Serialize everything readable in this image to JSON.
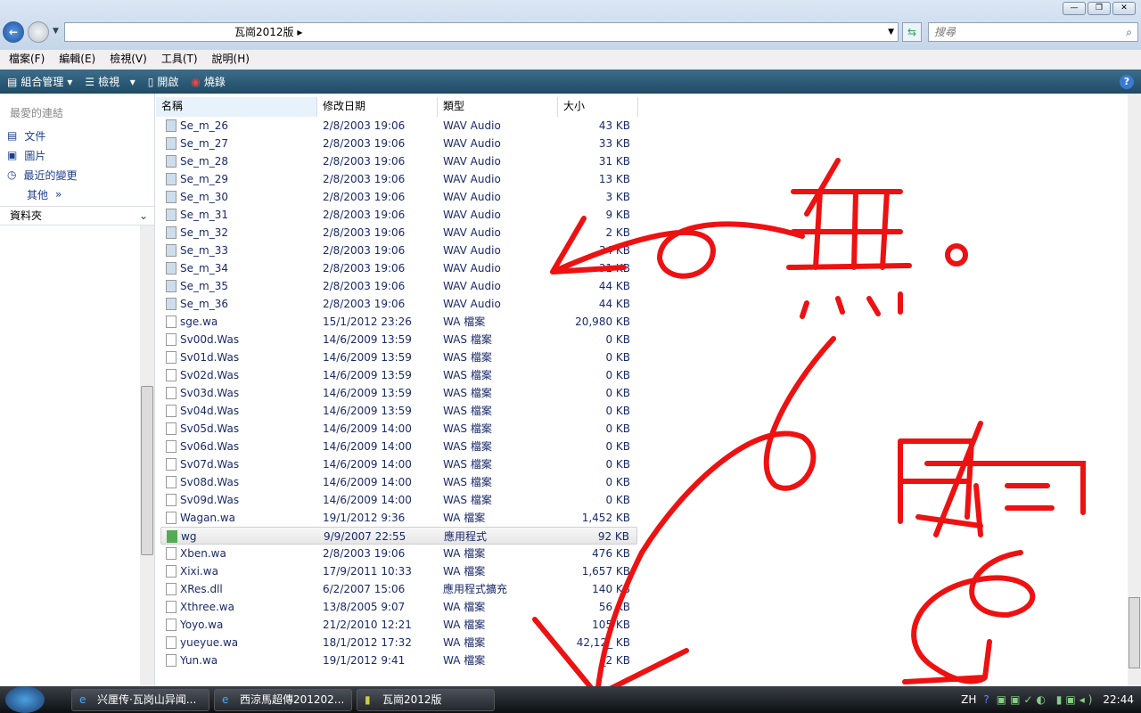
{
  "address": {
    "path": "瓦崗2012版",
    "search_placeholder": "搜尋"
  },
  "menu": [
    "檔案(F)",
    "編輯(E)",
    "檢視(V)",
    "工具(T)",
    "說明(H)"
  ],
  "toolbar": {
    "organize": "組合管理",
    "view": "檢視",
    "open": "開啟",
    "burn": "燒錄",
    "help": "?"
  },
  "nav": {
    "favorites_header": "最愛的連結",
    "items": [
      "文件",
      "圖片",
      "最近的變更",
      "其他"
    ],
    "folders": "資料夾"
  },
  "columns": [
    "名稱",
    "修改日期",
    "類型",
    "大小"
  ],
  "files": [
    [
      "Se_m_26",
      "2/8/2003 19:06",
      "WAV Audio",
      "43 KB"
    ],
    [
      "Se_m_27",
      "2/8/2003 19:06",
      "WAV Audio",
      "33 KB"
    ],
    [
      "Se_m_28",
      "2/8/2003 19:06",
      "WAV Audio",
      "31 KB"
    ],
    [
      "Se_m_29",
      "2/8/2003 19:06",
      "WAV Audio",
      "13 KB"
    ],
    [
      "Se_m_30",
      "2/8/2003 19:06",
      "WAV Audio",
      "3 KB"
    ],
    [
      "Se_m_31",
      "2/8/2003 19:06",
      "WAV Audio",
      "9 KB"
    ],
    [
      "Se_m_32",
      "2/8/2003 19:06",
      "WAV Audio",
      "2 KB"
    ],
    [
      "Se_m_33",
      "2/8/2003 19:06",
      "WAV Audio",
      "34 KB"
    ],
    [
      "Se_m_34",
      "2/8/2003 19:06",
      "WAV Audio",
      "31 KB"
    ],
    [
      "Se_m_35",
      "2/8/2003 19:06",
      "WAV Audio",
      "44 KB"
    ],
    [
      "Se_m_36",
      "2/8/2003 19:06",
      "WAV Audio",
      "44 KB"
    ],
    [
      "sge.wa",
      "15/1/2012 23:26",
      "WA 檔案",
      "20,980 KB"
    ],
    [
      "Sv00d.Was",
      "14/6/2009 13:59",
      "WAS 檔案",
      "0 KB"
    ],
    [
      "Sv01d.Was",
      "14/6/2009 13:59",
      "WAS 檔案",
      "0 KB"
    ],
    [
      "Sv02d.Was",
      "14/6/2009 13:59",
      "WAS 檔案",
      "0 KB"
    ],
    [
      "Sv03d.Was",
      "14/6/2009 13:59",
      "WAS 檔案",
      "0 KB"
    ],
    [
      "Sv04d.Was",
      "14/6/2009 13:59",
      "WAS 檔案",
      "0 KB"
    ],
    [
      "Sv05d.Was",
      "14/6/2009 14:00",
      "WAS 檔案",
      "0 KB"
    ],
    [
      "Sv06d.Was",
      "14/6/2009 14:00",
      "WAS 檔案",
      "0 KB"
    ],
    [
      "Sv07d.Was",
      "14/6/2009 14:00",
      "WAS 檔案",
      "0 KB"
    ],
    [
      "Sv08d.Was",
      "14/6/2009 14:00",
      "WAS 檔案",
      "0 KB"
    ],
    [
      "Sv09d.Was",
      "14/6/2009 14:00",
      "WAS 檔案",
      "0 KB"
    ],
    [
      "Wagan.wa",
      "19/1/2012 9:36",
      "WA 檔案",
      "1,452 KB"
    ],
    [
      "wg",
      "9/9/2007 22:55",
      "應用程式",
      "92 KB"
    ],
    [
      "Xben.wa",
      "2/8/2003 19:06",
      "WA 檔案",
      "476 KB"
    ],
    [
      "Xixi.wa",
      "17/9/2011 10:33",
      "WA 檔案",
      "1,657 KB"
    ],
    [
      "XRes.dll",
      "6/2/2007 15:06",
      "應用程式擴充",
      "140 KB"
    ],
    [
      "Xthree.wa",
      "13/8/2005 9:07",
      "WA 檔案",
      "56 KB"
    ],
    [
      "Yoyo.wa",
      "21/2/2010 12:21",
      "WA 檔案",
      "105 KB"
    ],
    [
      "yueyue.wa",
      "18/1/2012 17:32",
      "WA 檔案",
      "42,12_ KB"
    ],
    [
      "Yun.wa",
      "19/1/2012 9:41",
      "WA 檔案",
      "_2 KB"
    ]
  ],
  "selected_file": "wg",
  "annotation": {
    "text1": "無。",
    "text2": "只有",
    "color": "#ee1111"
  },
  "taskbar": {
    "items": [
      "兴厘传·瓦岗山异闻...",
      "西涼馬超傳201202...",
      "瓦崗2012版"
    ],
    "lang": "ZH",
    "clock": "22:44"
  }
}
